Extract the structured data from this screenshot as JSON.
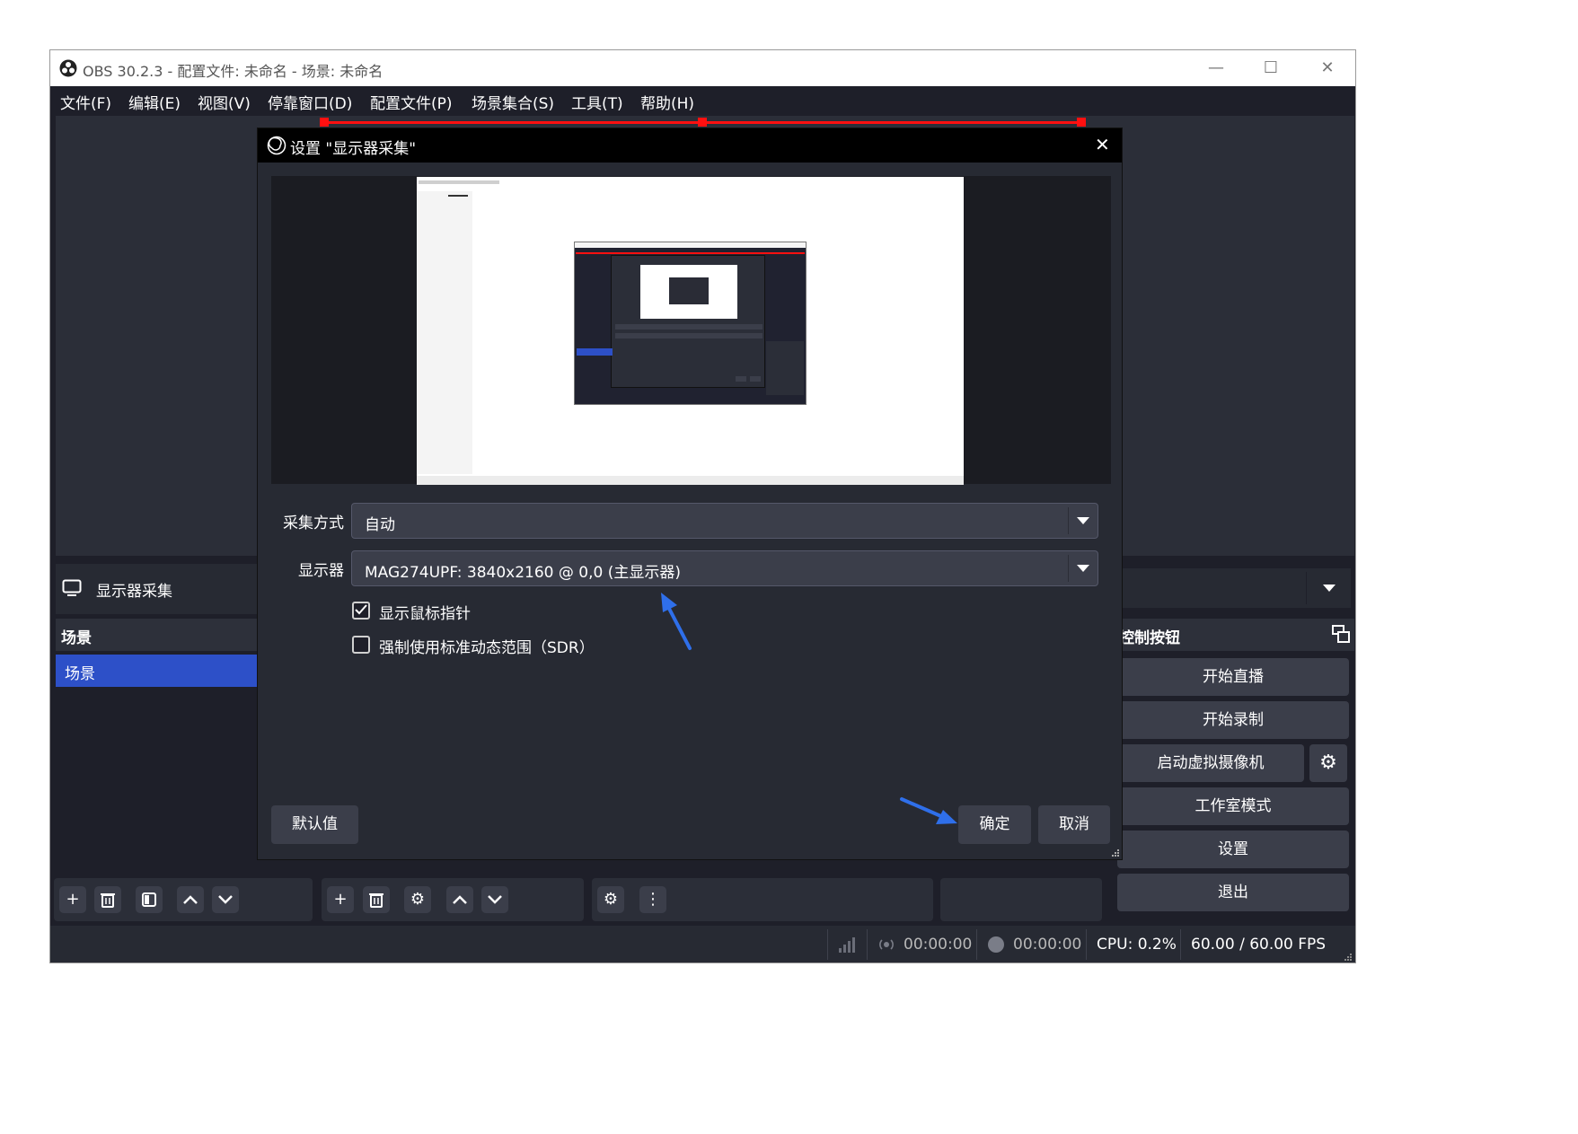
{
  "window": {
    "title": "OBS 30.2.3 - 配置文件: 未命名 - 场景: 未命名",
    "minimize_glyph": "—",
    "maximize_glyph": "☐",
    "close_glyph": "✕"
  },
  "menu": [
    "文件(F)",
    "编辑(E)",
    "视图(V)",
    "停靠窗口(D)",
    "配置文件(P)",
    "场景集合(S)",
    "工具(T)",
    "帮助(H)"
  ],
  "source_bar": {
    "label": "显示器采集"
  },
  "scenes": {
    "header": "场景",
    "items": [
      "场景"
    ]
  },
  "controls": {
    "header": "控制按钮",
    "start_streaming": "开始直播",
    "start_recording": "开始录制",
    "start_virtual_camera": "启动虚拟摄像机",
    "studio_mode": "工作室模式",
    "settings": "设置",
    "exit": "退出"
  },
  "status": {
    "stream_time": "00:00:00",
    "record_time": "00:00:00",
    "cpu": "CPU: 0.2%",
    "fps": "60.00 / 60.00 FPS"
  },
  "dialog": {
    "title": "设置 \"显示器采集\"",
    "capture_method_label": "采集方式",
    "capture_method_value": "自动",
    "display_label": "显示器",
    "display_value": "MAG274UPF: 3840x2160 @ 0,0 (主显示器)",
    "show_cursor_label": "显示鼠标指针",
    "show_cursor_checked": true,
    "force_sdr_label": "强制使用标准动态范围（SDR）",
    "force_sdr_checked": false,
    "defaults_button": "默认值",
    "ok_button": "确定",
    "cancel_button": "取消"
  },
  "icons": {
    "obs_logo": "obs-logo-icon",
    "monitor": "monitor-icon",
    "add": "plus-icon",
    "remove": "trash-icon",
    "filter": "filter-icon",
    "up": "chevron-up-icon",
    "down": "chevron-down-icon",
    "gear": "gear-icon",
    "more": "more-vertical-icon"
  },
  "colors": {
    "accent": "#2d50c8",
    "annotation_arrow": "#2f6fea",
    "preview_border": "#ff1010"
  }
}
